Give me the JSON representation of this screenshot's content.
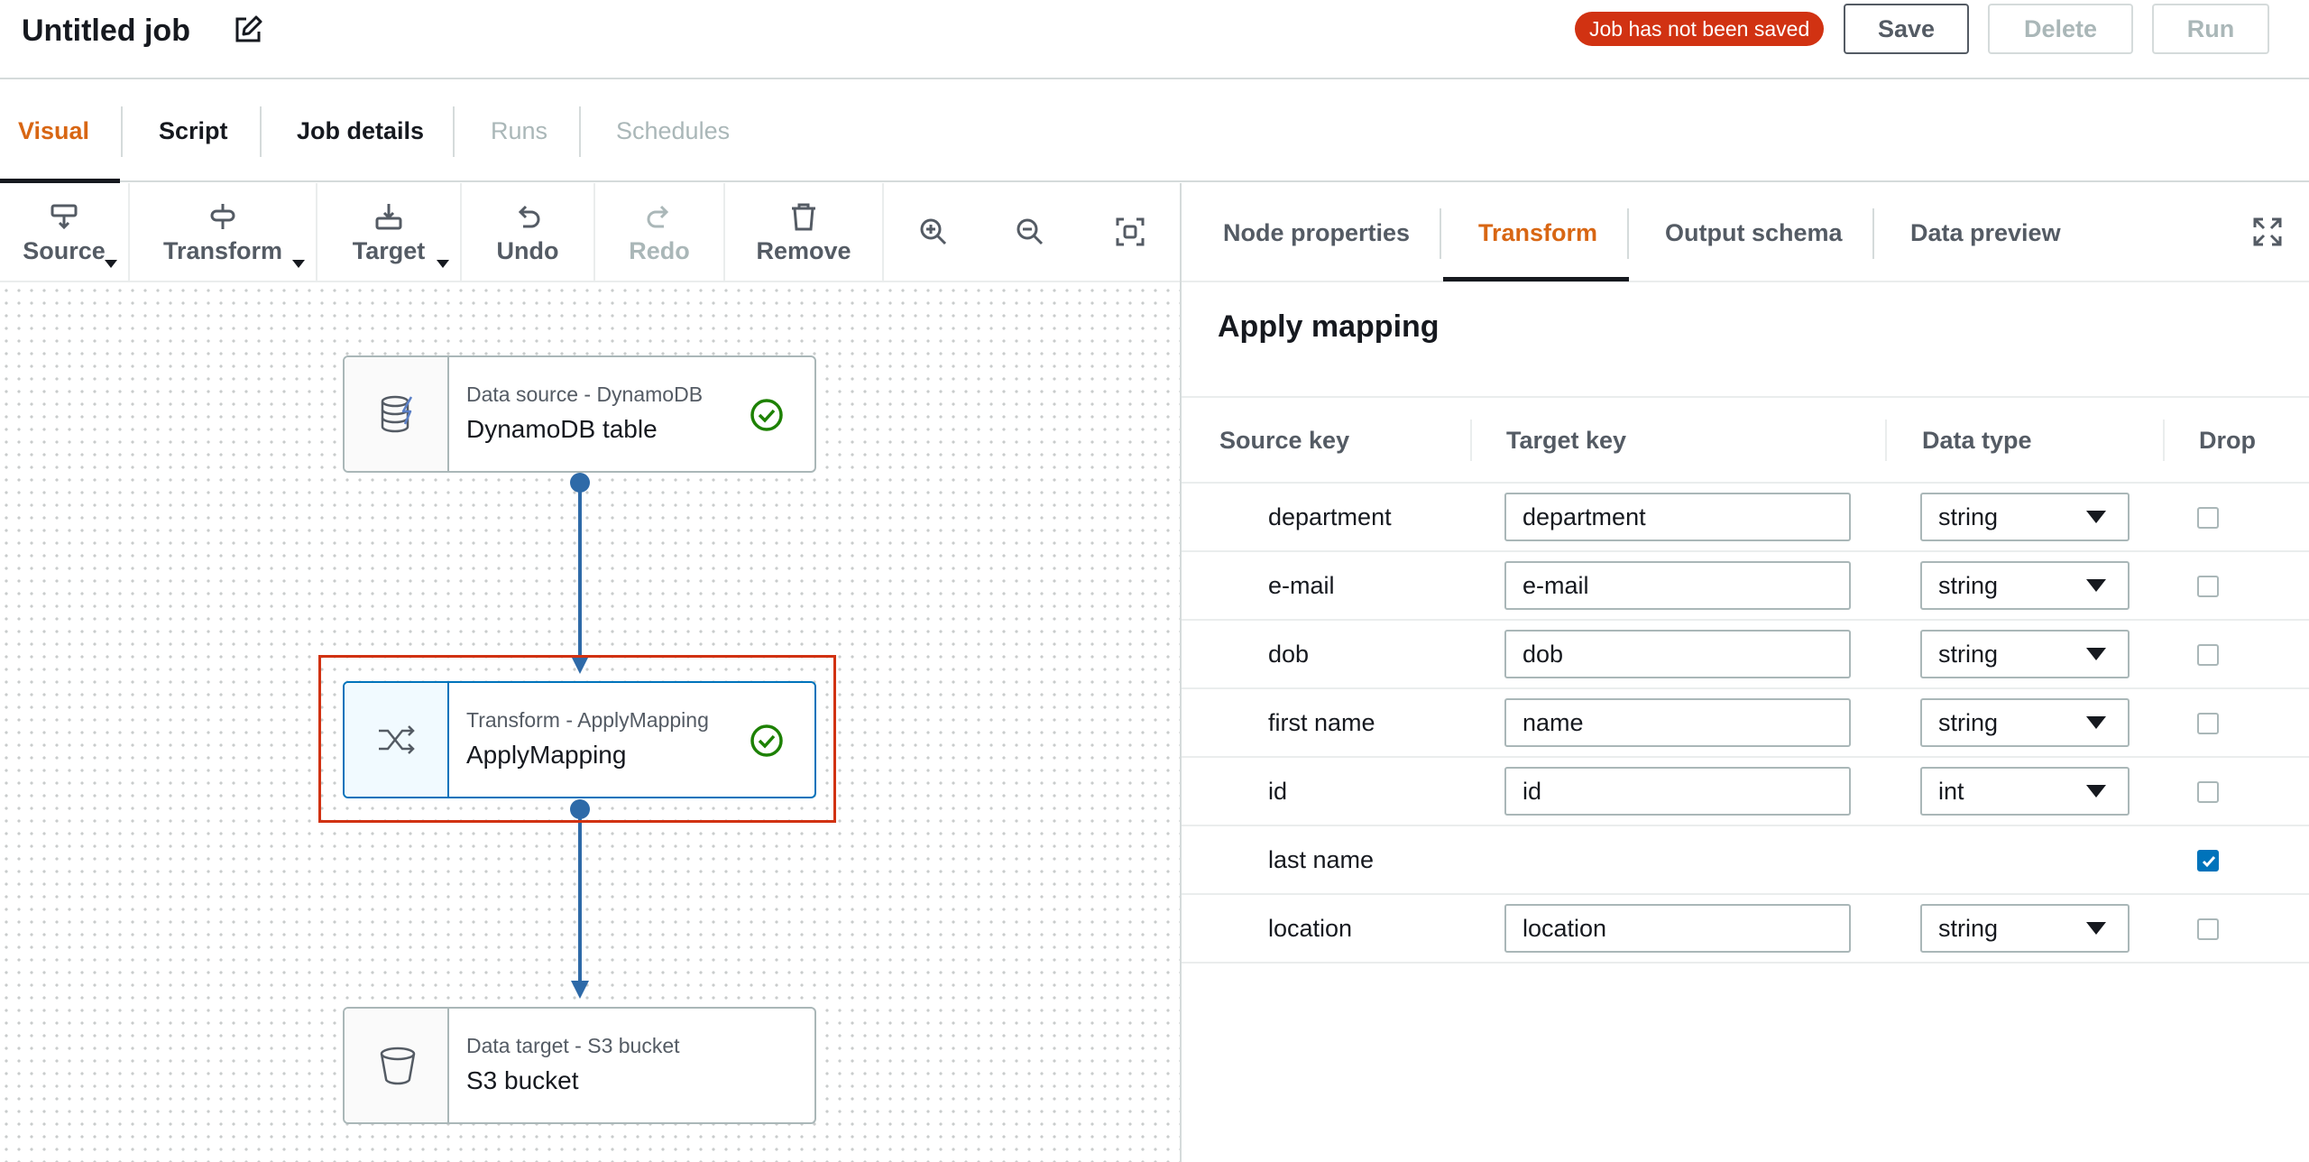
{
  "header": {
    "job_title": "Untitled job",
    "unsaved_badge": "Job has not been saved",
    "save_label": "Save",
    "delete_label": "Delete",
    "run_label": "Run"
  },
  "main_tabs": [
    {
      "label": "Visual",
      "state": "active"
    },
    {
      "label": "Script",
      "state": "normal"
    },
    {
      "label": "Job details",
      "state": "normal"
    },
    {
      "label": "Runs",
      "state": "disabled"
    },
    {
      "label": "Schedules",
      "state": "disabled"
    }
  ],
  "toolbar": {
    "source": "Source",
    "transform": "Transform",
    "target": "Target",
    "undo": "Undo",
    "redo": "Redo",
    "remove": "Remove"
  },
  "nodes": {
    "source": {
      "subtitle": "Data source - DynamoDB",
      "title": "DynamoDB table"
    },
    "transform": {
      "subtitle": "Transform - ApplyMapping",
      "title": "ApplyMapping"
    },
    "target": {
      "subtitle": "Data target - S3 bucket",
      "title": "S3 bucket"
    }
  },
  "panel": {
    "tabs": [
      {
        "label": "Node properties",
        "state": "normal"
      },
      {
        "label": "Transform",
        "state": "active"
      },
      {
        "label": "Output schema",
        "state": "normal"
      },
      {
        "label": "Data preview",
        "state": "normal"
      }
    ],
    "section_title": "Apply mapping",
    "columns": {
      "source_key": "Source key",
      "target_key": "Target key",
      "data_type": "Data type",
      "drop": "Drop"
    },
    "rows": [
      {
        "source": "department",
        "target": "department",
        "type": "string",
        "drop": false
      },
      {
        "source": "e-mail",
        "target": "e-mail",
        "type": "string",
        "drop": false
      },
      {
        "source": "dob",
        "target": "dob",
        "type": "string",
        "drop": false
      },
      {
        "source": "first name",
        "target": "name",
        "type": "string",
        "drop": false
      },
      {
        "source": "id",
        "target": "id",
        "type": "int",
        "drop": false
      },
      {
        "source": "last name",
        "target": "",
        "type": "",
        "drop": true
      },
      {
        "source": "location",
        "target": "location",
        "type": "string",
        "drop": false
      }
    ]
  },
  "colors": {
    "accent": "#d86613",
    "selection": "#0073bb",
    "badge": "#d13212",
    "success": "#1d8102"
  }
}
